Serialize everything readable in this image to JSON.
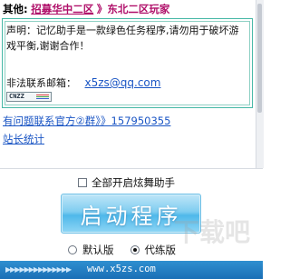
{
  "web": {
    "other_label": "其他:",
    "recruit_link": "招募华中二区",
    "recruit_tail": "》东北二区玩家",
    "declaration": "声明：记忆助手是一款绿色任务程序,请勿用于破坏游戏平衡,谢谢合作！",
    "contact_label": "非法联系邮箱：",
    "contact_email": "x5zs@qq.com",
    "cnzz_label": "CNZZ",
    "help_link": "有问题联系官方②群》》157950355",
    "stats_link": "站长统计"
  },
  "controls": {
    "dance_assistant_label": "全部开启炫舞助手",
    "dance_assistant_checked": false,
    "start_button_label": "启动程序",
    "version_options": [
      "默认版",
      "代练版"
    ],
    "selected_version": "代练版"
  },
  "footer": {
    "url": "www.x5zs.com",
    "arrows": "▶▶▶▶▶▶▶▶▶▶▶▶▶▶"
  },
  "colors": {
    "accent_pink": "#b0106a",
    "link_blue": "#1a55c4",
    "notice_border": "#46b8a6",
    "button_blue": "#4fb8ea",
    "footer_blue": "#1a6fb6"
  }
}
